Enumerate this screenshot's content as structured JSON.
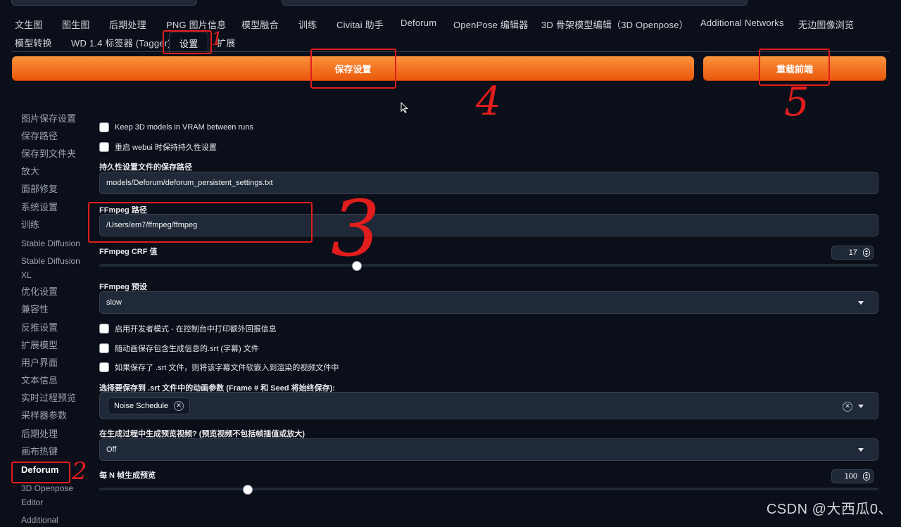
{
  "tabs_row1": [
    "文生图",
    "图生图",
    "后期处理",
    "PNG 图片信息",
    "模型融合",
    "训练",
    "Civitai 助手",
    "Deforum",
    "OpenPose 编辑器",
    "3D 骨架模型编辑（3D Openpose）",
    "Additional Networks",
    "无边图像浏览"
  ],
  "tabs_row2": [
    "模型转换",
    "WD 1.4 标签器 (Tagger)",
    "设置",
    "扩展"
  ],
  "buttons": {
    "save": "保存设置",
    "reload": "重载前端"
  },
  "sidebar": [
    "图片保存设置",
    "保存路径",
    "保存到文件夹",
    "放大",
    "面部修复",
    "系统设置",
    "训练",
    "Stable Diffusion",
    "Stable Diffusion XL",
    "优化设置",
    "兼容性",
    "反推设置",
    "扩展模型",
    "用户界面",
    "文本信息",
    "实时过程预览",
    "采样器参数",
    "后期处理",
    "画布热键",
    "Deforum",
    "3D Openpose Editor",
    "Additional"
  ],
  "settings": {
    "cb_keep_3d": "Keep 3D models in VRAM between runs",
    "cb_persist": "重启 webui 时保持持久性设置",
    "persist_path_label": "持久性设置文件的保存路径",
    "persist_path_value": "models/Deforum/deforum_persistent_settings.txt",
    "ffmpeg_path_label": "FFmpeg 路径",
    "ffmpeg_path_value": "/Users/em7/ffmpeg/ffmpeg",
    "crf_label": "FFmpeg CRF 值",
    "crf_value": "17",
    "crf_fraction": 0.33,
    "preset_label": "FFmpeg 预设",
    "preset_value": "slow",
    "cb_dev_mode": "启用开发者模式 - 在控制台中打印额外回报信息",
    "cb_srt": "随动画保存包含生成信息的.srt (字幕) 文件",
    "cb_embed_srt": "如果保存了 .srt 文件，则将该字幕文件软嵌入到渲染的视频文件中",
    "srt_params_label": "选择要保存到 .srt 文件中的动画参数 (Frame # 和 Seed 将始终保存):",
    "srt_chip": "Noise Schedule",
    "preview_label": "在生成过程中生成预览视频? (预览视频不包括帧插值或放大)",
    "preview_value": "Off",
    "nth_label": "每 N 帧生成预览",
    "nth_value": "100",
    "nth_fraction": 0.19
  },
  "annotations": [
    "1",
    "2",
    "3",
    "4",
    "5"
  ],
  "watermark": "CSDN @大西瓜0、",
  "colors": {
    "accent": "#f97316",
    "annotation_red": "#e11d1d",
    "background": "#0b0f19"
  }
}
